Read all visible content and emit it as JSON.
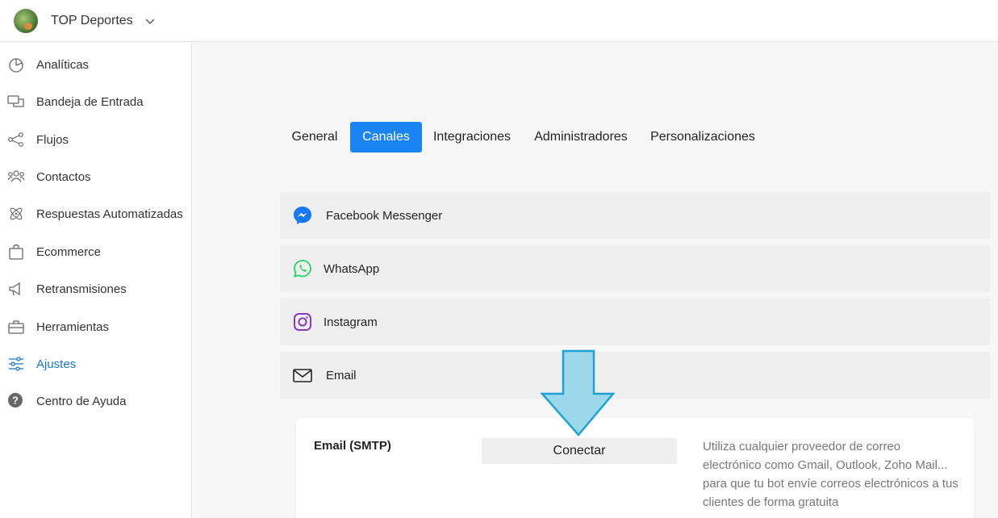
{
  "header": {
    "workspace_name": "TOP Deportes"
  },
  "sidebar": {
    "items": [
      {
        "label": "Analíticas",
        "icon": "pie-chart-icon"
      },
      {
        "label": "Bandeja de Entrada",
        "icon": "chat-bubbles-icon"
      },
      {
        "label": "Flujos",
        "icon": "flow-nodes-icon"
      },
      {
        "label": "Contactos",
        "icon": "users-icon"
      },
      {
        "label": "Respuestas Automatizadas",
        "icon": "atom-icon"
      },
      {
        "label": "Ecommerce",
        "icon": "shopping-bag-icon"
      },
      {
        "label": "Retransmisiones",
        "icon": "megaphone-icon"
      },
      {
        "label": "Herramientas",
        "icon": "toolbox-icon"
      },
      {
        "label": "Ajustes",
        "icon": "sliders-icon",
        "active": true
      },
      {
        "label": "Centro de Ayuda",
        "icon": "help-circle-icon"
      }
    ]
  },
  "tabs": [
    {
      "label": "General"
    },
    {
      "label": "Canales",
      "active": true
    },
    {
      "label": "Integraciones"
    },
    {
      "label": "Administradores"
    },
    {
      "label": "Personalizaciones"
    }
  ],
  "channels": [
    {
      "label": "Facebook Messenger",
      "icon": "messenger-icon"
    },
    {
      "label": "WhatsApp",
      "icon": "whatsapp-icon"
    },
    {
      "label": "Instagram",
      "icon": "instagram-icon"
    },
    {
      "label": "Email",
      "icon": "envelope-icon"
    }
  ],
  "email_card": {
    "title": "Email (SMTP)",
    "button_label": "Conectar",
    "description": "Utiliza cualquier proveedor de correo electrónico como Gmail, Outlook, Zoho Mail... para que tu bot envíe correos electrónicos a tus clientes de forma gratuita"
  },
  "colors": {
    "accent": "#1a84f3",
    "active_nav": "#1976d2",
    "messenger": "#1877f2",
    "whatsapp": "#25d366",
    "instagram": "#8a3ab9",
    "annotation_arrow": "#9dd8ea"
  }
}
